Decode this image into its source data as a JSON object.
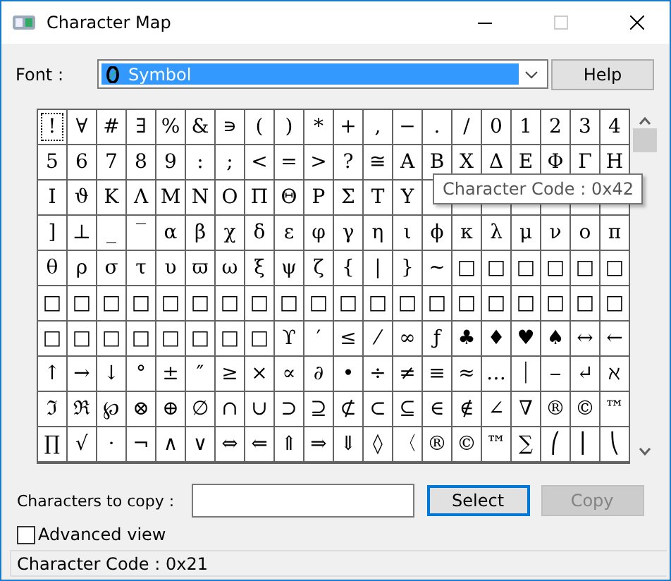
{
  "window": {
    "title": "Character Map"
  },
  "font": {
    "label": "Font :",
    "value": "Symbol"
  },
  "help_button": {
    "label": "Help"
  },
  "grid": {
    "rows": [
      [
        {
          "c": "!",
          "selected": true
        },
        {
          "c": "∀",
          "selected": false
        },
        {
          "c": "#",
          "selected": false
        },
        {
          "c": "∃",
          "selected": false
        },
        {
          "c": "%",
          "selected": false
        },
        {
          "c": "&",
          "selected": false
        },
        {
          "c": "∍",
          "selected": false
        },
        {
          "c": "(",
          "selected": false
        },
        {
          "c": ")",
          "selected": false
        },
        {
          "c": "*",
          "selected": false
        },
        {
          "c": "+",
          "selected": false
        },
        {
          "c": ",",
          "selected": false
        },
        {
          "c": "−",
          "selected": false
        },
        {
          "c": ".",
          "selected": false
        },
        {
          "c": "/",
          "selected": false
        },
        {
          "c": "0",
          "selected": false
        },
        {
          "c": "1",
          "selected": false
        },
        {
          "c": "2",
          "selected": false
        },
        {
          "c": "3",
          "selected": false
        },
        {
          "c": "4",
          "selected": false
        }
      ],
      [
        {
          "c": "5",
          "selected": false
        },
        {
          "c": "6",
          "selected": false
        },
        {
          "c": "7",
          "selected": false
        },
        {
          "c": "8",
          "selected": false
        },
        {
          "c": "9",
          "selected": false
        },
        {
          "c": ":",
          "selected": false
        },
        {
          "c": ";",
          "selected": false
        },
        {
          "c": "<",
          "selected": false
        },
        {
          "c": "=",
          "selected": false
        },
        {
          "c": ">",
          "selected": false
        },
        {
          "c": "?",
          "selected": false
        },
        {
          "c": "≅",
          "selected": false
        },
        {
          "c": "Α",
          "selected": false
        },
        {
          "c": "Β",
          "selected": false
        },
        {
          "c": "Χ",
          "selected": false
        },
        {
          "c": "Δ",
          "selected": false
        },
        {
          "c": "Ε",
          "selected": false
        },
        {
          "c": "Φ",
          "selected": false
        },
        {
          "c": "Γ",
          "selected": false
        },
        {
          "c": "Η",
          "selected": false
        }
      ],
      [
        {
          "c": "Ι",
          "selected": false
        },
        {
          "c": "ϑ",
          "selected": false
        },
        {
          "c": "Κ",
          "selected": false
        },
        {
          "c": "Λ",
          "selected": false
        },
        {
          "c": "Μ",
          "selected": false
        },
        {
          "c": "Ν",
          "selected": false
        },
        {
          "c": "Ο",
          "selected": false
        },
        {
          "c": "Π",
          "selected": false
        },
        {
          "c": "Θ",
          "selected": false
        },
        {
          "c": "Ρ",
          "selected": false
        },
        {
          "c": "Σ",
          "selected": false
        },
        {
          "c": "Τ",
          "selected": false
        },
        {
          "c": "Υ",
          "selected": false
        },
        {
          "selected": false
        },
        {
          "selected": false
        },
        {
          "selected": false
        },
        {
          "selected": false
        },
        {
          "selected": false
        },
        {
          "selected": false
        },
        {
          "selected": false
        }
      ],
      [
        {
          "c": "]",
          "selected": false
        },
        {
          "c": "⊥",
          "selected": false
        },
        {
          "c": "_",
          "selected": false
        },
        {
          "c": "‾",
          "selected": false
        },
        {
          "c": "α",
          "selected": false
        },
        {
          "c": "β",
          "selected": false
        },
        {
          "c": "χ",
          "selected": false
        },
        {
          "c": "δ",
          "selected": false
        },
        {
          "c": "ε",
          "selected": false
        },
        {
          "c": "φ",
          "selected": false
        },
        {
          "c": "γ",
          "selected": false
        },
        {
          "c": "η",
          "selected": false
        },
        {
          "c": "ι",
          "selected": false
        },
        {
          "c": "ϕ",
          "selected": false
        },
        {
          "c": "κ",
          "selected": false
        },
        {
          "c": "λ",
          "selected": false
        },
        {
          "c": "μ",
          "selected": false
        },
        {
          "c": "ν",
          "selected": false
        },
        {
          "c": "ο",
          "selected": false
        },
        {
          "c": "π",
          "selected": false
        }
      ],
      [
        {
          "c": "θ",
          "selected": false
        },
        {
          "c": "ρ",
          "selected": false
        },
        {
          "c": "σ",
          "selected": false
        },
        {
          "c": "τ",
          "selected": false
        },
        {
          "c": "υ",
          "selected": false
        },
        {
          "c": "ϖ",
          "selected": false
        },
        {
          "c": "ω",
          "selected": false
        },
        {
          "c": "ξ",
          "selected": false
        },
        {
          "c": "ψ",
          "selected": false
        },
        {
          "c": "ζ",
          "selected": false
        },
        {
          "c": "{",
          "selected": false
        },
        {
          "c": "|",
          "selected": false
        },
        {
          "c": "}",
          "selected": false
        },
        {
          "c": "∼",
          "selected": false
        },
        {
          "c": "□",
          "selected": false
        },
        {
          "c": "□",
          "selected": false
        },
        {
          "c": "□",
          "selected": false
        },
        {
          "c": "□",
          "selected": false
        },
        {
          "c": "□",
          "selected": false
        },
        {
          "c": "□",
          "selected": false
        }
      ],
      [
        {
          "c": "□",
          "selected": false
        },
        {
          "c": "□",
          "selected": false
        },
        {
          "c": "□",
          "selected": false
        },
        {
          "c": "□",
          "selected": false
        },
        {
          "c": "□",
          "selected": false
        },
        {
          "c": "□",
          "selected": false
        },
        {
          "c": "□",
          "selected": false
        },
        {
          "c": "□",
          "selected": false
        },
        {
          "c": "□",
          "selected": false
        },
        {
          "c": "□",
          "selected": false
        },
        {
          "c": "□",
          "selected": false
        },
        {
          "c": "□",
          "selected": false
        },
        {
          "c": "□",
          "selected": false
        },
        {
          "c": "□",
          "selected": false
        },
        {
          "c": "□",
          "selected": false
        },
        {
          "c": "□",
          "selected": false
        },
        {
          "c": "□",
          "selected": false
        },
        {
          "c": "□",
          "selected": false
        },
        {
          "c": "□",
          "selected": false
        },
        {
          "c": "□",
          "selected": false
        }
      ],
      [
        {
          "c": "□",
          "selected": false
        },
        {
          "c": "□",
          "selected": false
        },
        {
          "c": "□",
          "selected": false
        },
        {
          "c": "□",
          "selected": false
        },
        {
          "c": "□",
          "selected": false
        },
        {
          "c": "□",
          "selected": false
        },
        {
          "c": "□",
          "selected": false
        },
        {
          "c": "□",
          "selected": false
        },
        {
          "c": "ϒ",
          "selected": false
        },
        {
          "c": "′",
          "selected": false
        },
        {
          "c": "≤",
          "selected": false
        },
        {
          "c": "⁄",
          "selected": false
        },
        {
          "c": "∞",
          "selected": false
        },
        {
          "c": "ƒ",
          "selected": false
        },
        {
          "c": "♣",
          "selected": false
        },
        {
          "c": "♦",
          "selected": false
        },
        {
          "c": "♥",
          "selected": false
        },
        {
          "c": "♠",
          "selected": false
        },
        {
          "c": "↔",
          "selected": false
        },
        {
          "c": "←",
          "selected": false
        }
      ],
      [
        {
          "c": "↑",
          "selected": false
        },
        {
          "c": "→",
          "selected": false
        },
        {
          "c": "↓",
          "selected": false
        },
        {
          "c": "°",
          "selected": false
        },
        {
          "c": "±",
          "selected": false
        },
        {
          "c": "″",
          "selected": false
        },
        {
          "c": "≥",
          "selected": false
        },
        {
          "c": "×",
          "selected": false
        },
        {
          "c": "∝",
          "selected": false
        },
        {
          "c": "∂",
          "selected": false
        },
        {
          "c": "•",
          "selected": false
        },
        {
          "c": "÷",
          "selected": false
        },
        {
          "c": "≠",
          "selected": false
        },
        {
          "c": "≡",
          "selected": false
        },
        {
          "c": "≈",
          "selected": false
        },
        {
          "c": "…",
          "selected": false
        },
        {
          "c": "⏐",
          "selected": false
        },
        {
          "c": "⎯",
          "selected": false
        },
        {
          "c": "↵",
          "selected": false
        },
        {
          "c": "ℵ",
          "selected": false
        }
      ],
      [
        {
          "c": "ℑ",
          "selected": false
        },
        {
          "c": "ℜ",
          "selected": false
        },
        {
          "c": "℘",
          "selected": false
        },
        {
          "c": "⊗",
          "selected": false
        },
        {
          "c": "⊕",
          "selected": false
        },
        {
          "c": "∅",
          "selected": false
        },
        {
          "c": "∩",
          "selected": false
        },
        {
          "c": "∪",
          "selected": false
        },
        {
          "c": "⊃",
          "selected": false
        },
        {
          "c": "⊇",
          "selected": false
        },
        {
          "c": "⊄",
          "selected": false
        },
        {
          "c": "⊂",
          "selected": false
        },
        {
          "c": "⊆",
          "selected": false
        },
        {
          "c": "∈",
          "selected": false
        },
        {
          "c": "∉",
          "selected": false
        },
        {
          "c": "∠",
          "selected": false
        },
        {
          "c": "∇",
          "selected": false
        },
        {
          "c": "®",
          "selected": false
        },
        {
          "c": "©",
          "selected": false
        },
        {
          "c": "™",
          "selected": false
        }
      ],
      [
        {
          "c": "∏",
          "selected": false
        },
        {
          "c": "√",
          "selected": false
        },
        {
          "c": "⋅",
          "selected": false
        },
        {
          "c": "¬",
          "selected": false
        },
        {
          "c": "∧",
          "selected": false
        },
        {
          "c": "∨",
          "selected": false
        },
        {
          "c": "⇔",
          "selected": false
        },
        {
          "c": "⇐",
          "selected": false
        },
        {
          "c": "⇑",
          "selected": false
        },
        {
          "c": "⇒",
          "selected": false
        },
        {
          "c": "⇓",
          "selected": false
        },
        {
          "c": "◊",
          "selected": false
        },
        {
          "c": "〈",
          "selected": false
        },
        {
          "c": "®",
          "selected": false
        },
        {
          "c": "©",
          "selected": false
        },
        {
          "c": "™",
          "selected": false
        },
        {
          "c": "∑",
          "selected": false
        },
        {
          "c": "⎛",
          "selected": false
        },
        {
          "c": "⎜",
          "selected": false
        },
        {
          "c": "⎝",
          "selected": false
        }
      ]
    ]
  },
  "tooltip": {
    "text": "Character Code : 0x42"
  },
  "copy_row": {
    "label": "Characters to copy :"
  },
  "buttons": [
    {
      "label": "Select",
      "default": true,
      "disabled": false
    },
    {
      "label": "Copy",
      "default": false,
      "disabled": true
    }
  ],
  "advanced_view": {
    "label": "Advanced view",
    "checked": false
  },
  "status_bar": {
    "text": "Character Code : 0x21"
  }
}
